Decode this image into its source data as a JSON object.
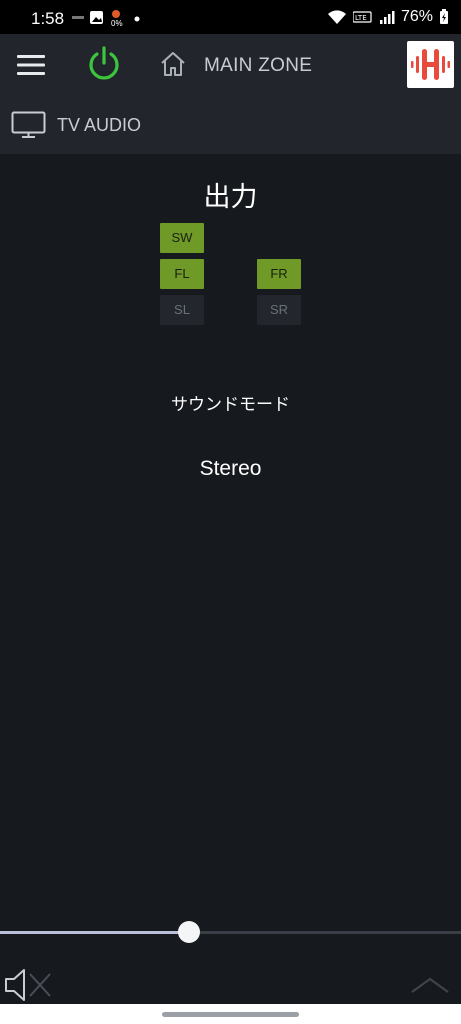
{
  "status_bar": {
    "time": "1:58",
    "battery": "76%",
    "icons": [
      "denon-notification-icon",
      "gallery-icon",
      "data-usage-icon",
      "dot-icon",
      "wifi-icon",
      "volte-icon",
      "signal-icon",
      "battery-charging-icon"
    ],
    "data_usage_text": "0%"
  },
  "app_bar": {
    "zone_title": "MAIN ZONE",
    "power_color": "#3cc63c",
    "logo_color": "#e84a3c"
  },
  "input_bar": {
    "label": "TV AUDIO"
  },
  "output": {
    "title": "出力",
    "channels": {
      "sw": {
        "label": "SW",
        "active": true
      },
      "fl": {
        "label": "FL",
        "active": true
      },
      "fr": {
        "label": "FR",
        "active": true
      },
      "sl": {
        "label": "SL",
        "active": false
      },
      "sr": {
        "label": "SR",
        "active": false
      }
    }
  },
  "sound_mode": {
    "label": "サウンドモード",
    "value": "Stereo"
  },
  "volume": {
    "level_fraction": 0.41,
    "muted": true
  },
  "colors": {
    "background": "#16191e",
    "bar": "#22262c",
    "active_channel": "#6f9a28",
    "inactive_channel": "#23272d"
  }
}
